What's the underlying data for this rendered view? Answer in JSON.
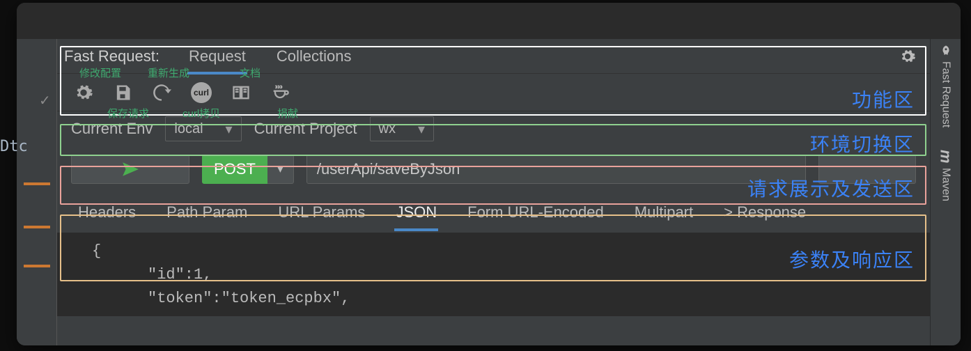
{
  "panel": {
    "title": "Fast Request:",
    "tabs": [
      {
        "label": "Request",
        "active": true
      },
      {
        "label": "Collections",
        "active": false
      }
    ]
  },
  "toolbar": {
    "captions": {
      "settings": "修改配置",
      "regenerate": "重新生成",
      "doc": "文档",
      "save": "保存请求",
      "curl": "curl拷贝",
      "donate": "捐献"
    }
  },
  "env": {
    "env_label": "Current Env",
    "env_value": "local",
    "project_label": "Current Project",
    "project_value": "wx"
  },
  "request": {
    "method": "POST",
    "url": "/userApi/saveByJson"
  },
  "param_tabs": [
    {
      "label": "Headers",
      "active": false
    },
    {
      "label": "Path Param",
      "active": false
    },
    {
      "label": "URL Params",
      "active": false
    },
    {
      "label": "JSON",
      "active": true
    },
    {
      "label": "Form URL-Encoded",
      "active": false
    },
    {
      "label": "Multipart",
      "active": false
    },
    {
      "label": "> Response",
      "active": false
    }
  ],
  "json_body": {
    "line1": "{",
    "line2": "\"id\":1,",
    "line3": "\"token\":\"token_ecpbx\","
  },
  "regions": {
    "func": "功能区",
    "env": "环境切换区",
    "send": "请求展示及发送区",
    "param": "参数及响应区"
  },
  "right_rail": {
    "fast_request": "Fast Request",
    "maven": "Maven"
  },
  "misc": {
    "dtc": "Dtc"
  }
}
